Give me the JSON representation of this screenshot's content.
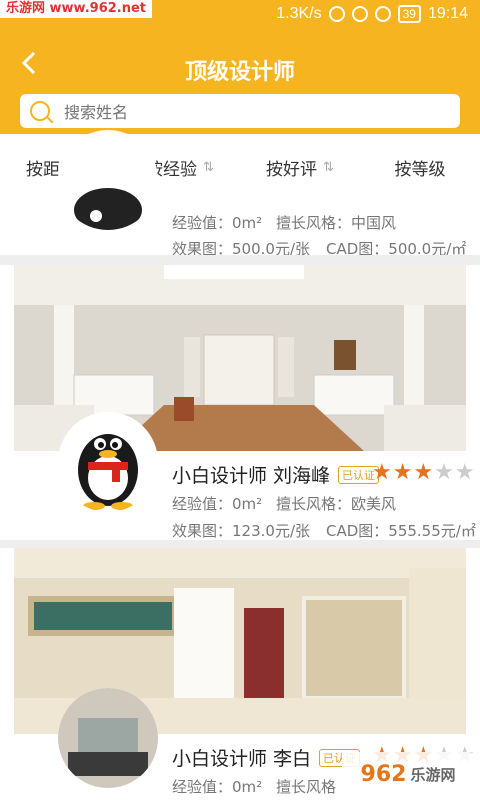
{
  "status_bar": {
    "speed": "1.3K/s",
    "battery": "39",
    "time": "19:14",
    "watermark": "乐游网 www.962.net"
  },
  "header": {
    "title": "顶级设计师"
  },
  "search": {
    "placeholder": "搜索姓名"
  },
  "tabs": [
    {
      "label": "按距离",
      "active": true
    },
    {
      "label": "按经验",
      "active": false
    },
    {
      "label": "按好评",
      "active": false
    },
    {
      "label": "按等级",
      "active": false
    }
  ],
  "designers": [
    {
      "name": "",
      "badge": "",
      "rating": 0,
      "experience": "经验值：0m²",
      "style": "擅长风格：中国风",
      "render_price": "效果图：500.0元/张",
      "cad_price": "CAD图：500.0元/㎡"
    },
    {
      "name": "小白设计师 刘海峰",
      "badge": "已认证",
      "rating": 3,
      "experience": "经验值：0m²",
      "style": "擅长风格：欧美风",
      "render_price": "效果图：123.0元/张",
      "cad_price": "CAD图：555.55元/㎡"
    },
    {
      "name": "小白设计师 李白",
      "badge": "已认证",
      "rating": 3,
      "experience": "经验值：0m²",
      "style": "擅长风格",
      "render_price": "",
      "cad_price": ""
    }
  ],
  "watermark_bottom": {
    "brand": "962",
    "suffix": "乐游网"
  },
  "colors": {
    "accent": "#f6b421",
    "star": "#e6721e"
  }
}
